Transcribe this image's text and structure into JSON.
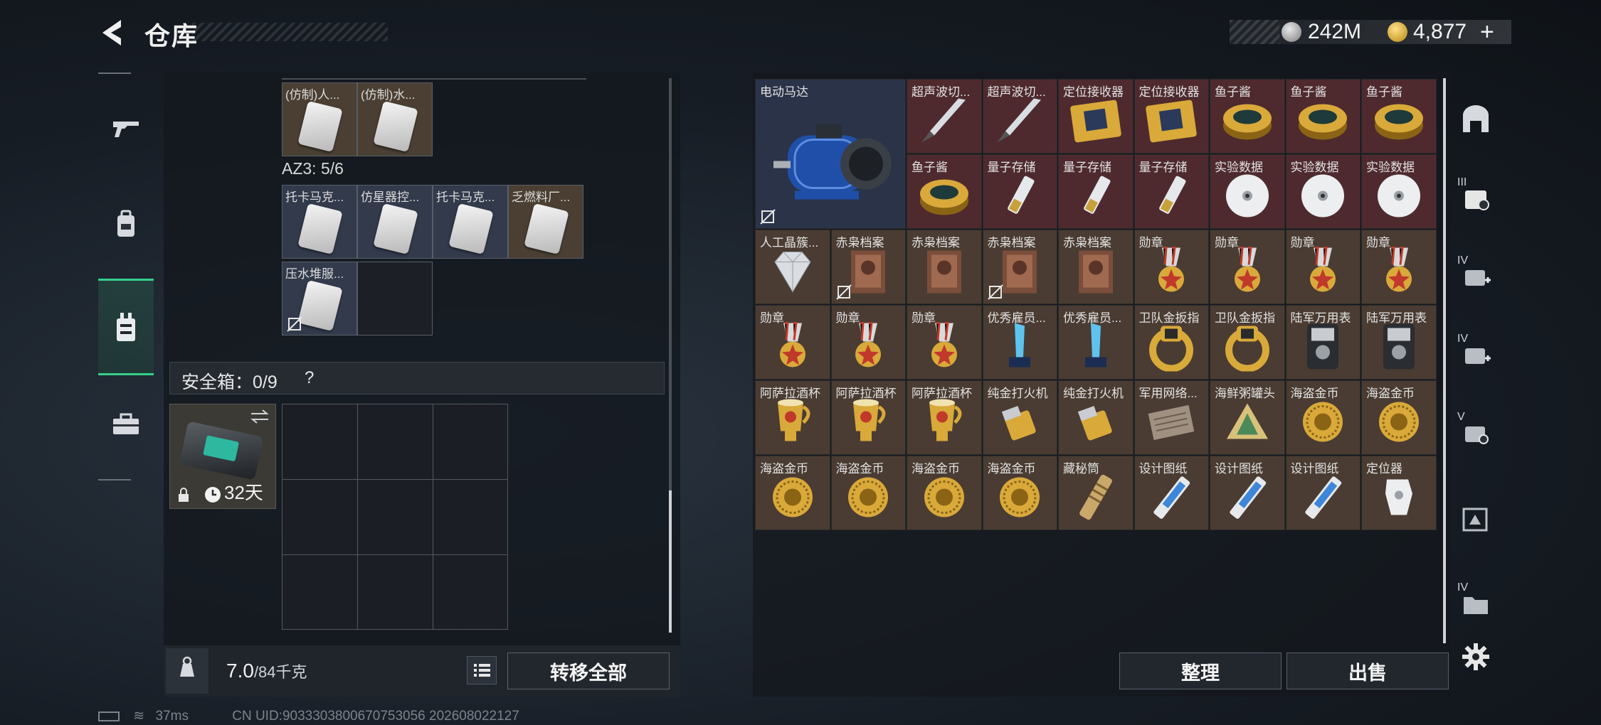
{
  "header": {
    "title": "仓库",
    "currency_silver": "242M",
    "currency_gold": "4,877",
    "currency_add": "+"
  },
  "left_nav": [
    "gun-icon",
    "backpack-icon",
    "vest-icon",
    "toolbox-icon"
  ],
  "left_panel": {
    "top_items": [
      "(仿制)人...",
      "(仿制)水..."
    ],
    "az3_label": "AZ3: 5/6",
    "az3_items": [
      "托卡马克...",
      "仿星器控...",
      "托卡马克...",
      "乏燃料厂...",
      "压水堆服..."
    ],
    "safe_box_label": "安全箱：0/9",
    "safe_box_help": "?",
    "safe_box_days": "32天",
    "weight_value": "7.0",
    "weight_unit": "/84千克",
    "transfer_all": "转移全部"
  },
  "right_panel": {
    "items": [
      {
        "name": "电动马达",
        "icon": "motor"
      },
      {
        "name": "超声波切...",
        "icon": "knife"
      },
      {
        "name": "超声波切...",
        "icon": "knife"
      },
      {
        "name": "定位接收器",
        "icon": "board"
      },
      {
        "name": "定位接收器",
        "icon": "board"
      },
      {
        "name": "鱼子酱",
        "icon": "caviar"
      },
      {
        "name": "鱼子酱",
        "icon": "caviar"
      },
      {
        "name": "鱼子酱",
        "icon": "caviar"
      },
      {
        "name": "鱼子酱",
        "icon": "caviar"
      },
      {
        "name": "量子存储",
        "icon": "usb"
      },
      {
        "name": "量子存储",
        "icon": "usb"
      },
      {
        "name": "量子存储",
        "icon": "usb"
      },
      {
        "name": "实验数据",
        "icon": "disc"
      },
      {
        "name": "实验数据",
        "icon": "disc"
      },
      {
        "name": "实验数据",
        "icon": "disc"
      },
      {
        "name": "人工晶簇...",
        "icon": "diamond"
      },
      {
        "name": "赤枭档案",
        "icon": "file"
      },
      {
        "name": "赤枭档案",
        "icon": "file"
      },
      {
        "name": "赤枭档案",
        "icon": "file"
      },
      {
        "name": "赤枭档案",
        "icon": "file"
      },
      {
        "name": "勋章",
        "icon": "medal"
      },
      {
        "name": "勋章",
        "icon": "medal"
      },
      {
        "name": "勋章",
        "icon": "medal"
      },
      {
        "name": "勋章",
        "icon": "medal"
      },
      {
        "name": "勋章",
        "icon": "medal"
      },
      {
        "name": "勋章",
        "icon": "medal"
      },
      {
        "name": "勋章",
        "icon": "medal"
      },
      {
        "name": "优秀雇员...",
        "icon": "trophy"
      },
      {
        "name": "优秀雇员...",
        "icon": "trophy"
      },
      {
        "name": "卫队金扳指",
        "icon": "ring"
      },
      {
        "name": "卫队金扳指",
        "icon": "ring"
      },
      {
        "name": "陆军万用表",
        "icon": "meter"
      },
      {
        "name": "陆军万用表",
        "icon": "meter"
      },
      {
        "name": "阿萨拉酒杯",
        "icon": "cup"
      },
      {
        "name": "阿萨拉酒杯",
        "icon": "cup"
      },
      {
        "name": "阿萨拉酒杯",
        "icon": "cup"
      },
      {
        "name": "纯金打火机",
        "icon": "lighter"
      },
      {
        "name": "纯金打火机",
        "icon": "lighter"
      },
      {
        "name": "军用网络...",
        "icon": "net"
      },
      {
        "name": "海鲜粥罐头",
        "icon": "can"
      },
      {
        "name": "海盗金币",
        "icon": "coin"
      },
      {
        "name": "海盗金币",
        "icon": "coin"
      },
      {
        "name": "海盗金币",
        "icon": "coin"
      },
      {
        "name": "海盗金币",
        "icon": "coin"
      },
      {
        "name": "海盗金币",
        "icon": "coin"
      },
      {
        "name": "海盗金币",
        "icon": "coin"
      },
      {
        "name": "藏秘筒",
        "icon": "cylinder"
      },
      {
        "name": "设计图纸",
        "icon": "blueprint"
      },
      {
        "name": "设计图纸",
        "icon": "blueprint"
      },
      {
        "name": "设计图纸",
        "icon": "blueprint"
      },
      {
        "name": "定位器",
        "icon": "tracker"
      }
    ],
    "sort_label": "整理",
    "sell_label": "出售"
  },
  "right_nav": [
    {
      "label": "",
      "icon": "arch-icon"
    },
    {
      "label": "III",
      "icon": "backpack-tier3-icon"
    },
    {
      "label": "IV",
      "icon": "backpack-tier4-icon"
    },
    {
      "label": "IV",
      "icon": "backpack-tier4b-icon"
    },
    {
      "label": "V",
      "icon": "backpack-tier5-icon"
    },
    {
      "label": "",
      "icon": "ammo-box-icon"
    },
    {
      "label": "IV",
      "icon": "folder-tier4-icon"
    },
    {
      "label": "",
      "icon": "settings-gear-icon"
    }
  ],
  "status_bar": {
    "ping": "37ms",
    "uid": "CN UID:9033303800670753056 202608022127"
  }
}
